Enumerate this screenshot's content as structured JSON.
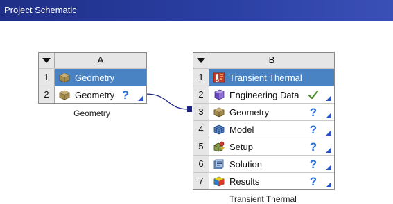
{
  "window": {
    "title": "Project Schematic"
  },
  "system_a": {
    "column_letter": "A",
    "caption": "Geometry",
    "rows": [
      {
        "num": "1",
        "label": "Geometry",
        "icon": "geometry-icon"
      },
      {
        "num": "2",
        "label": "Geometry",
        "icon": "geometry-icon",
        "status_icon": "question-status-icon"
      }
    ]
  },
  "system_b": {
    "column_letter": "B",
    "caption": "Transient Thermal",
    "rows": [
      {
        "num": "1",
        "label": "Transient Thermal",
        "icon": "transient-thermal-icon"
      },
      {
        "num": "2",
        "label": "Engineering Data",
        "icon": "engineering-data-icon",
        "status_icon": "check-status-icon"
      },
      {
        "num": "3",
        "label": "Geometry",
        "icon": "geometry-icon",
        "status_icon": "question-status-icon"
      },
      {
        "num": "4",
        "label": "Model",
        "icon": "model-icon",
        "status_icon": "question-status-icon"
      },
      {
        "num": "5",
        "label": "Setup",
        "icon": "setup-icon",
        "status_icon": "question-status-icon"
      },
      {
        "num": "6",
        "label": "Solution",
        "icon": "solution-icon",
        "status_icon": "question-status-icon"
      },
      {
        "num": "7",
        "label": "Results",
        "icon": "results-icon",
        "status_icon": "question-status-icon"
      }
    ]
  },
  "colors": {
    "titlebar": "#2a3fa2",
    "selected_row": "#4a83c4",
    "link": "#1a237e",
    "status_question": "#2a70d6",
    "status_check": "#4a8a2a"
  }
}
